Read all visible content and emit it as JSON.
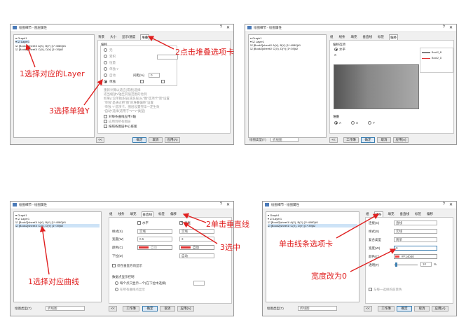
{
  "colors": {
    "annotation": "#e02020",
    "window_bg": "#f0f0f0",
    "accent_red": "#e03030"
  },
  "annotations": {
    "a1": "1选择对应的Layer",
    "a2": "2点击堆叠选项卡",
    "a3": "3选择单独Y",
    "b1": "2单击垂直线",
    "b2": "3选中",
    "b3": "1选择对应曲线",
    "c1": "单击线条选项卡",
    "c2": "宽度改为0"
  },
  "win1": {
    "title": "绘图细节 - 图层属性",
    "tree": [
      "▾ Graph1",
      "  ▾ ☑ Layer1",
      "      ☑ [Book2]sheet1! A(X), B(Y) [1*:4080]#1",
      "      ☑ [Book2]sheet1! C(X), D(Y) [1*:39]#2"
    ],
    "tabs": [
      "背景",
      "大小",
      "显示/速度",
      "堆叠"
    ],
    "group_label": "偏移",
    "radios": [
      "无",
      "累积",
      "恒量",
      "单独 Y",
      "自动",
      "单独"
    ],
    "gap_label": "间距(%)",
    "gap_value": "0",
    "notes": [
      "重新计算以适应(或者)选择",
      "适当缩放Y轴至其值范围的比例",
      "如果y:沿单独多层(或多层)从\"图\"选项卡\"第\"设置",
      "\"单独\"是通过把\"图\"的堆叠偏移\"设置",
      "\"单独 Y\"选项卡，图层设置完毕一定生效",
      "\"自动\"选择(适用于\"Y\"\"Y\"类型)"
    ],
    "checks": [
      "对每条曲线应用Y轴",
      "应用到所有图层",
      "按照各图层中心排版"
    ],
    "buttons": [
      "<<",
      "确定",
      "取消",
      "应用(A)"
    ]
  },
  "win2": {
    "title": "绘图细节 - 绘图属性",
    "tree": [
      "▾ Graph1",
      "  ▾ ☑ Layer1",
      "      ☑ [Book2]sheet1! A(X), B(Y) [1*:4080]#1",
      "      ☑ [Book2]sheet1! C(X), D(Y) [1*:39]#2"
    ],
    "tabs": [
      "组",
      "线条",
      "填充",
      "垂直线",
      "标签",
      "偏移"
    ],
    "group_label": "偏移选项",
    "radio_x": "水平",
    "offset_note": "X",
    "legend_items": [
      "Book2_B",
      "Book2_D"
    ],
    "stack_label": "堆叠",
    "stack_opts": [
      "A",
      "X",
      "Y"
    ],
    "footer_label": "绘图类型(T)",
    "footer_value": "折线图",
    "buttons": [
      "<<",
      "工作簿",
      "确定",
      "取消",
      "应用(A)"
    ]
  },
  "win3": {
    "title": "绘图细节 - 绘图属性",
    "tree": [
      "▾ Graph1",
      "  ▾ ☑ Layer1",
      "      ☑ [Book2]sheet1! A(X), B(Y) [1*:4080]#1",
      "      ☑ [Book2]sheet1! C(X), D(Y) [1*:39]#2"
    ],
    "tabs": [
      "组",
      "线条",
      "填充",
      "垂直线",
      "标签",
      "偏移"
    ],
    "active_tab": "垂直线",
    "col_h": "水平",
    "col_v": "垂直",
    "row_style": "样式(S)",
    "row_width": "宽度(W)",
    "row_color": "颜色(C)",
    "row_drop": "下拉(D)",
    "style_h": "实线",
    "style_v": "实线",
    "width_h": "0.5",
    "width_v": "3",
    "color_h": "自动",
    "color_v": "自动",
    "drop_value": "自动",
    "check_label": "仅在垂直方向显示",
    "group2": "数据点显示控制",
    "opt1": "每个点只显示一个(在下拉中选择)",
    "opt2": "在所有曲线点显示",
    "footer_label": "绘图类型(T)",
    "footer_value": "折线图",
    "buttons": [
      "<<",
      "工作簿",
      "确定",
      "取消",
      "应用(A)"
    ]
  },
  "win4": {
    "title": "绘图细节 - 绘图属性",
    "tree": [
      "▾ Graph1",
      "  ▾ ☑ Layer1",
      "      ☑ [Book2]sheet1! A(X), B(Y) [1*:4080]#1",
      "      ☑ [Book2]sheet1! C(X), D(Y) [1*:39]#2"
    ],
    "tabs": [
      "组",
      "线条",
      "填充",
      "垂直线",
      "标签",
      "偏移"
    ],
    "rows": [
      "连接(C)",
      "样式(S)",
      "复合类型",
      "宽度(W)",
      "颜色(C)",
      "透明(T)"
    ],
    "values": [
      "直线",
      "实线",
      "简单",
      "0",
      "#F14040",
      "10"
    ],
    "pct": "%",
    "check_label": "与每一选择的前景色",
    "footer_label": "绘图类型(T)",
    "footer_value": "折线图",
    "buttons": [
      "<<",
      "工作簿",
      "确定",
      "取消",
      "应用(A)"
    ]
  }
}
